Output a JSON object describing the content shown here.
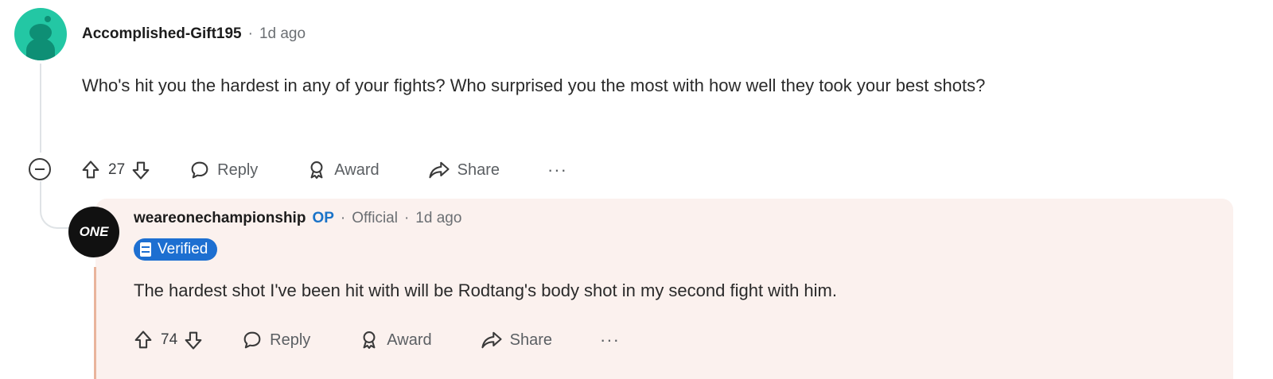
{
  "comment": {
    "username": "Accomplished-Gift195",
    "separator": "·",
    "time": "1d ago",
    "body": "Who's hit you the hardest in any of your fights? Who surprised you the most with how well they took your best shots?",
    "votes": "27",
    "actions": {
      "reply": "Reply",
      "award": "Award",
      "share": "Share",
      "more": "···"
    }
  },
  "reply": {
    "avatar_text": "ONE",
    "username": "weareonechampionship",
    "op_label": "OP",
    "separator": "·",
    "official": "Official",
    "separator2": "·",
    "time": "1d ago",
    "flair": "Verified",
    "body": "The hardest shot I've been hit with will be Rodtang's body shot in my second fight with him.",
    "votes": "74",
    "actions": {
      "reply": "Reply",
      "award": "Award",
      "share": "Share",
      "more": "···"
    }
  },
  "colors": {
    "avatar_bg": "#23c7a4",
    "reply_highlight": "#fbf1ee",
    "op_blue": "#1a73c8",
    "verified_badge": "#1d6fd1"
  }
}
